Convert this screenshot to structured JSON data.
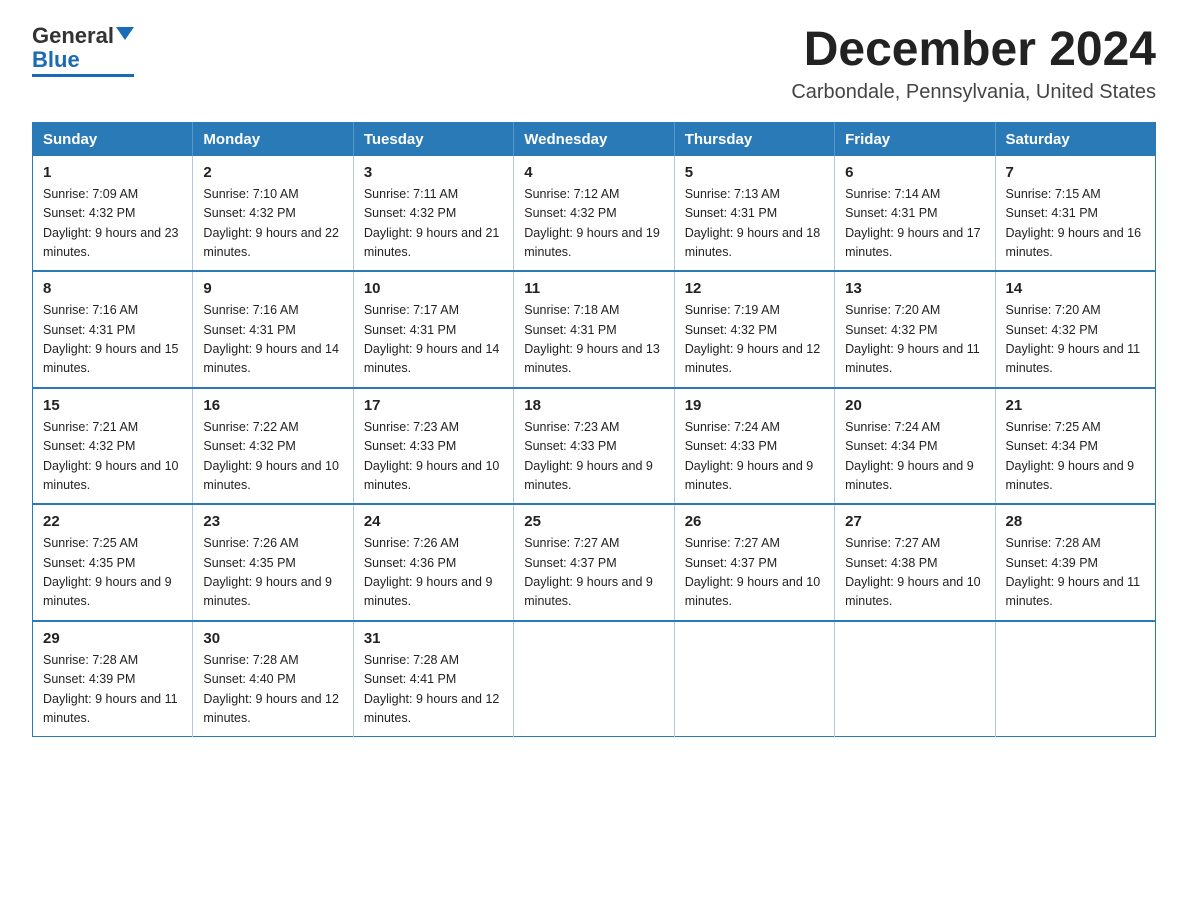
{
  "logo": {
    "text_general": "General",
    "text_blue": "Blue"
  },
  "header": {
    "month": "December 2024",
    "location": "Carbondale, Pennsylvania, United States"
  },
  "weekdays": [
    "Sunday",
    "Monday",
    "Tuesday",
    "Wednesday",
    "Thursday",
    "Friday",
    "Saturday"
  ],
  "weeks": [
    [
      {
        "day": "1",
        "sunrise": "7:09 AM",
        "sunset": "4:32 PM",
        "daylight": "9 hours and 23 minutes."
      },
      {
        "day": "2",
        "sunrise": "7:10 AM",
        "sunset": "4:32 PM",
        "daylight": "9 hours and 22 minutes."
      },
      {
        "day": "3",
        "sunrise": "7:11 AM",
        "sunset": "4:32 PM",
        "daylight": "9 hours and 21 minutes."
      },
      {
        "day": "4",
        "sunrise": "7:12 AM",
        "sunset": "4:32 PM",
        "daylight": "9 hours and 19 minutes."
      },
      {
        "day": "5",
        "sunrise": "7:13 AM",
        "sunset": "4:31 PM",
        "daylight": "9 hours and 18 minutes."
      },
      {
        "day": "6",
        "sunrise": "7:14 AM",
        "sunset": "4:31 PM",
        "daylight": "9 hours and 17 minutes."
      },
      {
        "day": "7",
        "sunrise": "7:15 AM",
        "sunset": "4:31 PM",
        "daylight": "9 hours and 16 minutes."
      }
    ],
    [
      {
        "day": "8",
        "sunrise": "7:16 AM",
        "sunset": "4:31 PM",
        "daylight": "9 hours and 15 minutes."
      },
      {
        "day": "9",
        "sunrise": "7:16 AM",
        "sunset": "4:31 PM",
        "daylight": "9 hours and 14 minutes."
      },
      {
        "day": "10",
        "sunrise": "7:17 AM",
        "sunset": "4:31 PM",
        "daylight": "9 hours and 14 minutes."
      },
      {
        "day": "11",
        "sunrise": "7:18 AM",
        "sunset": "4:31 PM",
        "daylight": "9 hours and 13 minutes."
      },
      {
        "day": "12",
        "sunrise": "7:19 AM",
        "sunset": "4:32 PM",
        "daylight": "9 hours and 12 minutes."
      },
      {
        "day": "13",
        "sunrise": "7:20 AM",
        "sunset": "4:32 PM",
        "daylight": "9 hours and 11 minutes."
      },
      {
        "day": "14",
        "sunrise": "7:20 AM",
        "sunset": "4:32 PM",
        "daylight": "9 hours and 11 minutes."
      }
    ],
    [
      {
        "day": "15",
        "sunrise": "7:21 AM",
        "sunset": "4:32 PM",
        "daylight": "9 hours and 10 minutes."
      },
      {
        "day": "16",
        "sunrise": "7:22 AM",
        "sunset": "4:32 PM",
        "daylight": "9 hours and 10 minutes."
      },
      {
        "day": "17",
        "sunrise": "7:23 AM",
        "sunset": "4:33 PM",
        "daylight": "9 hours and 10 minutes."
      },
      {
        "day": "18",
        "sunrise": "7:23 AM",
        "sunset": "4:33 PM",
        "daylight": "9 hours and 9 minutes."
      },
      {
        "day": "19",
        "sunrise": "7:24 AM",
        "sunset": "4:33 PM",
        "daylight": "9 hours and 9 minutes."
      },
      {
        "day": "20",
        "sunrise": "7:24 AM",
        "sunset": "4:34 PM",
        "daylight": "9 hours and 9 minutes."
      },
      {
        "day": "21",
        "sunrise": "7:25 AM",
        "sunset": "4:34 PM",
        "daylight": "9 hours and 9 minutes."
      }
    ],
    [
      {
        "day": "22",
        "sunrise": "7:25 AM",
        "sunset": "4:35 PM",
        "daylight": "9 hours and 9 minutes."
      },
      {
        "day": "23",
        "sunrise": "7:26 AM",
        "sunset": "4:35 PM",
        "daylight": "9 hours and 9 minutes."
      },
      {
        "day": "24",
        "sunrise": "7:26 AM",
        "sunset": "4:36 PM",
        "daylight": "9 hours and 9 minutes."
      },
      {
        "day": "25",
        "sunrise": "7:27 AM",
        "sunset": "4:37 PM",
        "daylight": "9 hours and 9 minutes."
      },
      {
        "day": "26",
        "sunrise": "7:27 AM",
        "sunset": "4:37 PM",
        "daylight": "9 hours and 10 minutes."
      },
      {
        "day": "27",
        "sunrise": "7:27 AM",
        "sunset": "4:38 PM",
        "daylight": "9 hours and 10 minutes."
      },
      {
        "day": "28",
        "sunrise": "7:28 AM",
        "sunset": "4:39 PM",
        "daylight": "9 hours and 11 minutes."
      }
    ],
    [
      {
        "day": "29",
        "sunrise": "7:28 AM",
        "sunset": "4:39 PM",
        "daylight": "9 hours and 11 minutes."
      },
      {
        "day": "30",
        "sunrise": "7:28 AM",
        "sunset": "4:40 PM",
        "daylight": "9 hours and 12 minutes."
      },
      {
        "day": "31",
        "sunrise": "7:28 AM",
        "sunset": "4:41 PM",
        "daylight": "9 hours and 12 minutes."
      },
      null,
      null,
      null,
      null
    ]
  ]
}
